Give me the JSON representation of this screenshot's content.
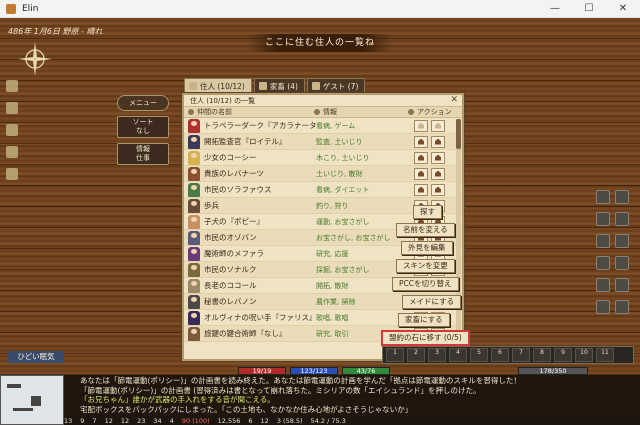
{
  "window": {
    "title": "Elin",
    "controls": [
      "—",
      "☐",
      "✕"
    ]
  },
  "hud": {
    "date": "486年 1月6日 野原 - 晴れ",
    "banner": "ここに住む住人の一覧ね",
    "weather": "ひどい眠気"
  },
  "sidebar": {
    "menu": "メニュー",
    "sort_line1": "ソート",
    "sort_line2": "なし",
    "job_line1": "情報",
    "job_line2": "仕事"
  },
  "tabs": [
    {
      "label": "住人 (10/12)"
    },
    {
      "label": "家畜 (4)"
    },
    {
      "label": "ゲスト (7)"
    }
  ],
  "panel": {
    "title": "住人 (10/12) の一覧",
    "close": "✕",
    "col_name": "仲間の名前",
    "col_info": "情報",
    "col_action": "アクション"
  },
  "residents": [
    {
      "name": "トラベラーダーク『アカラナータ』",
      "info": "看病, ゲーム",
      "color": "#b03030"
    },
    {
      "name": "開拓監査官『ロイテル』",
      "info": "監査, 土いじり",
      "color": "#3a3a5a"
    },
    {
      "name": "少女のコーシー",
      "info": "木こり, 土いじり",
      "color": "#d8b24a"
    },
    {
      "name": "貴族のレバナーツ",
      "info": "土いじり, 散財",
      "color": "#8a5030"
    },
    {
      "name": "市民のソラファウス",
      "info": "看病, ダイエット",
      "color": "#4a7a4a"
    },
    {
      "name": "歩兵",
      "info": "釣り, 狩り",
      "color": "#6a4a3a"
    },
    {
      "name": "子犬の『ポピー』",
      "info": "運動, お宝さがし",
      "color": "#c89060"
    },
    {
      "name": "市民のオゾバン",
      "info": "お宝さがし, お宝さがし",
      "color": "#5a5a7a"
    },
    {
      "name": "魔術師のメファラ",
      "info": "研究, 応援",
      "color": "#6a3a7a"
    },
    {
      "name": "市民のソナルク",
      "info": "採掘, お宝さがし",
      "color": "#7a6a3a"
    },
    {
      "name": "長老のココール",
      "info": "開拓, 散財",
      "color": "#9a8a6a"
    },
    {
      "name": "秘書のレバノン",
      "info": "農作業, 掃除",
      "color": "#4a4a4a"
    },
    {
      "name": "オルヴィナの呪い手『ファリス』",
      "info": "歌唱, 歌唱",
      "color": "#3a2a5a"
    },
    {
      "name": "旅鍵の鍵合術師『なし』",
      "info": "研究, 取引",
      "color": "#7a5a3a"
    }
  ],
  "context_menu": [
    "探す",
    "名前を変える",
    "外見を編集",
    "スキンを変更",
    "PCCを切り替え",
    "メイドにする",
    "家畜にする",
    "盟約の石に移す (0/5)"
  ],
  "status": {
    "hp": "19/19",
    "mp": "123/123",
    "sp": "43/76",
    "exp": "178/350"
  },
  "hotbar": [
    "1",
    "2",
    "3",
    "4",
    "5",
    "6",
    "7",
    "8",
    "9",
    "10",
    "11"
  ],
  "log": [
    "あなたは「節電運動(ポリシー)」の計画書を読み終えた。あなたは節電運動の計画を学んだ「拠点は節電運動のスキルを習得した！",
    "「節電運動(ポリシー)」の計画書 (習得済みは書となって崩れ落ちた。ミシリアの数「エイシュランド」を押しのけた。",
    "「お兄ちゃん」誰かが武器の手入れをする音が聞こえる。",
    "宅配ボックスをバックパックにしまった。「この土地も、なかなか住み心地がよさそうじゃないか」"
  ],
  "bottom_stats": [
    "13",
    "9",
    "7",
    "12",
    "12",
    "23",
    "34",
    "4",
    "90 (100)",
    "12,556",
    "6",
    "12",
    "3 (58.5)",
    "54.2 / 75.3"
  ],
  "colors": {
    "accent": "#d23a3a",
    "panel_bg": "#efe3c4",
    "wood": "#6b3d1a"
  }
}
